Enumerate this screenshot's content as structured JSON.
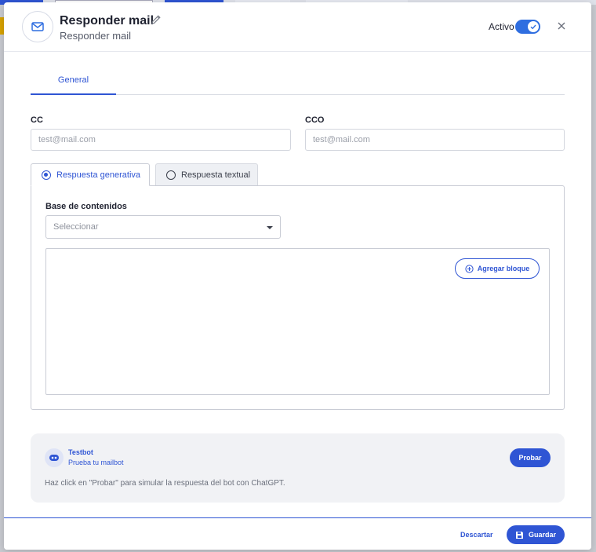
{
  "header": {
    "title": "Responder mail",
    "subtitle": "Responder mail",
    "active_label": "Activo",
    "active": true
  },
  "tabs": [
    {
      "label": "General",
      "selected": true
    }
  ],
  "cc": {
    "label": "CC",
    "placeholder": "test@mail.com",
    "value": ""
  },
  "cco": {
    "label": "CCO",
    "placeholder": "test@mail.com",
    "value": ""
  },
  "response_tabs": [
    {
      "label": "Respuesta generativa",
      "selected": true
    },
    {
      "label": "Respuesta textual",
      "selected": false
    }
  ],
  "knowledge_base": {
    "label": "Base de contenidos",
    "placeholder": "Seleccionar"
  },
  "blocks": {
    "add_label": "Agregar bloque"
  },
  "testbot": {
    "name": "Testbot",
    "subtitle": "Prueba tu mailbot",
    "hint": "Haz click en \"Probar\" para simular la respuesta del bot con ChatGPT.",
    "try_label": "Probar"
  },
  "footer": {
    "discard_label": "Descartar",
    "save_label": "Guardar"
  },
  "colors": {
    "accent": "#2f55d4",
    "toggle": "#2f6ee0",
    "panel_bg": "#f1f2f5"
  },
  "icons": {
    "header": "mail-icon",
    "edit": "pencil-icon",
    "close": "close-icon",
    "add": "plus-circle-icon",
    "bot": "bot-icon",
    "save": "floppy-disk-icon"
  }
}
